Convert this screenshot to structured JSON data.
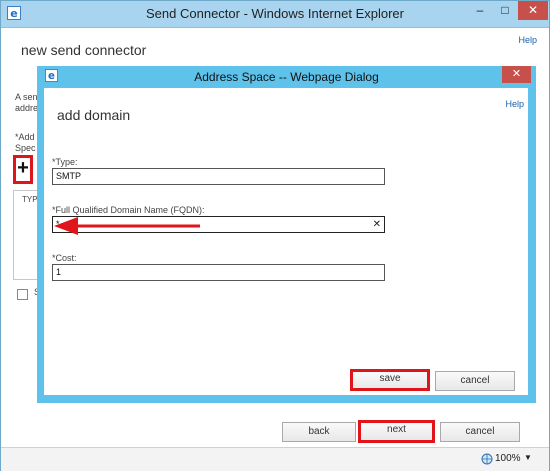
{
  "outer_window": {
    "title": "Send Connector - Windows Internet Explorer",
    "heading": "new send connector",
    "help": "Help",
    "minimize": "–",
    "maximize": "□",
    "close": "✕",
    "bg_text_1": "A sen",
    "bg_text_2": "addre",
    "bg_text_3": "*Add",
    "bg_text_4": "Spec",
    "add_button": "+",
    "list_header": "TYP",
    "checkbox_label": "S",
    "back_label": "back",
    "next_label": "next",
    "cancel_label": "cancel",
    "zoom": "100%",
    "zoom_arrow": "▼"
  },
  "dialog": {
    "title": "Address Space -- Webpage Dialog",
    "close": "✕",
    "heading": "add domain",
    "help": "Help",
    "type_label": "*Type:",
    "type_value": "SMTP",
    "fqdn_label": "*Full Qualified Domain Name (FQDN):",
    "fqdn_value": "*",
    "fqdn_clear": "✕",
    "cost_label": "*Cost:",
    "cost_value": "1",
    "save_label": "save",
    "cancel_label": "cancel"
  },
  "colors": {
    "highlight": "#e0151b",
    "dialog_frame": "#5ec2ea",
    "outer_titlebar": "#a9d4ef",
    "close_button": "#c7504a"
  },
  "icons": {
    "title_icon": "ie-icon",
    "zoom_icon": "zoom-globe-icon"
  }
}
